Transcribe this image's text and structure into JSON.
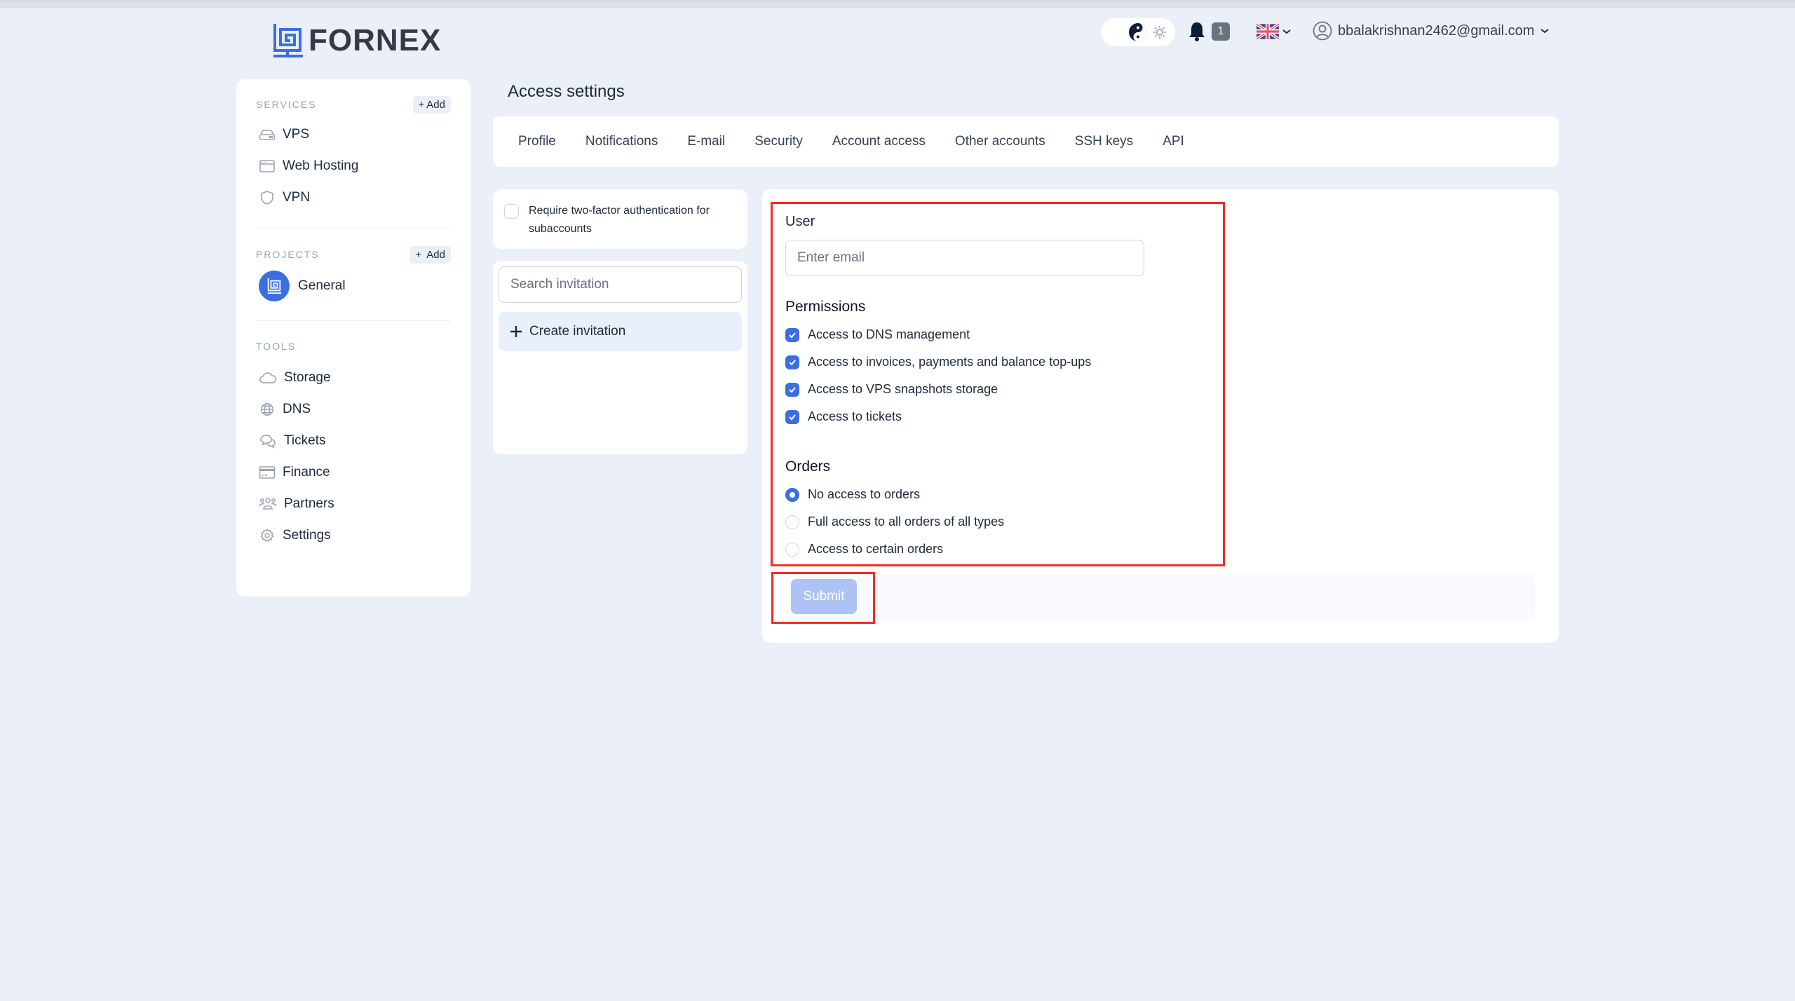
{
  "brand": {
    "name": "FORNEX",
    "accent": "#3b6fe0"
  },
  "header": {
    "theme_icons": [
      "moon-icon",
      "yin-yang-icon",
      "sun-icon"
    ],
    "notifications_count": "1",
    "language": "en-GB",
    "user_email": "bbalakrishnan2462@gmail.com"
  },
  "sidebar": {
    "services": {
      "label": "SERVICES",
      "add_label": "Add",
      "items": [
        {
          "label": "VPS",
          "icon": "server-icon"
        },
        {
          "label": "Web Hosting",
          "icon": "browser-window-icon"
        },
        {
          "label": "VPN",
          "icon": "shield-icon"
        }
      ]
    },
    "projects": {
      "label": "PROJECTS",
      "add_label": "Add",
      "items": [
        {
          "label": "General",
          "icon": "fornex-logo-icon"
        }
      ]
    },
    "tools": {
      "label": "TOOLS",
      "items": [
        {
          "label": "Storage",
          "icon": "cloud-icon"
        },
        {
          "label": "DNS",
          "icon": "globe-icon"
        },
        {
          "label": "Tickets",
          "icon": "chat-bubbles-icon"
        },
        {
          "label": "Finance",
          "icon": "credit-card-icon"
        },
        {
          "label": "Partners",
          "icon": "users-icon"
        },
        {
          "label": "Settings",
          "icon": "gear-icon"
        }
      ]
    }
  },
  "main": {
    "title": "Access settings",
    "tabs": [
      {
        "label": "Profile"
      },
      {
        "label": "Notifications"
      },
      {
        "label": "E-mail"
      },
      {
        "label": "Security"
      },
      {
        "label": "Account access"
      },
      {
        "label": "Other accounts"
      },
      {
        "label": "SSH keys"
      },
      {
        "label": "API"
      }
    ],
    "twofa": {
      "label": "Require two-factor authentication for subaccounts",
      "checked": false
    },
    "invitations": {
      "search_placeholder": "Search invitation",
      "create_label": "Create invitation"
    },
    "form": {
      "user_label": "User",
      "email_placeholder": "Enter email",
      "permissions_title": "Permissions",
      "permissions": [
        {
          "label": "Access to DNS management",
          "checked": true
        },
        {
          "label": "Access to invoices, payments and balance top-ups",
          "checked": true
        },
        {
          "label": "Access to VPS snapshots storage",
          "checked": true
        },
        {
          "label": "Access to tickets",
          "checked": true
        }
      ],
      "orders_title": "Orders",
      "orders": [
        {
          "label": "No access to orders",
          "selected": true
        },
        {
          "label": "Full access to all orders of all types",
          "selected": false
        },
        {
          "label": "Access to certain orders",
          "selected": false
        }
      ],
      "submit_label": "Submit"
    }
  }
}
